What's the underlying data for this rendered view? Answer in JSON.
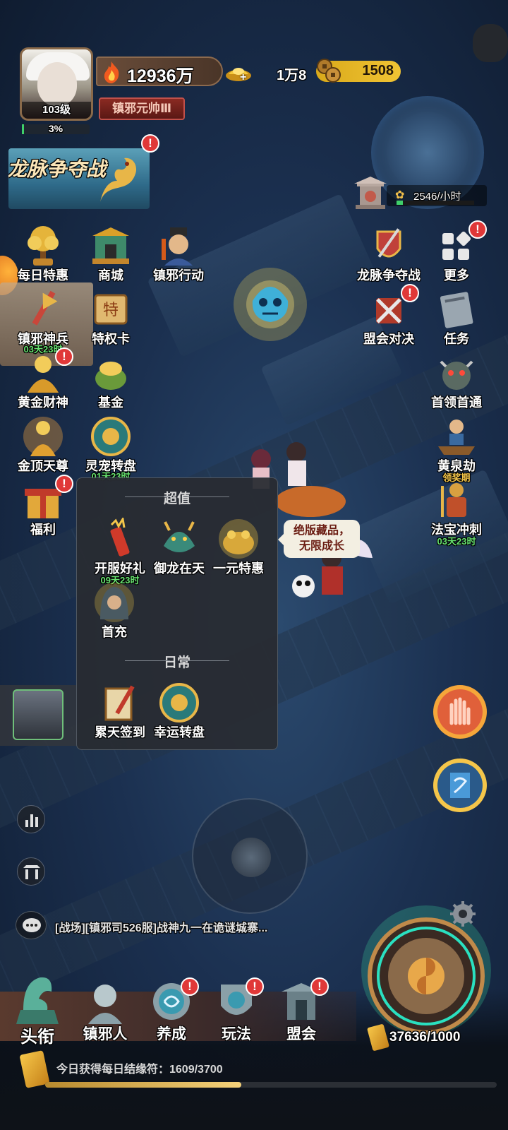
{
  "player": {
    "level": "103级",
    "exp_percent": "3%",
    "exp_fraction": 0.03,
    "combat_power": "12936万",
    "title": "镇邪元帅Ⅲ"
  },
  "currency": {
    "ingot_amount": "1万8",
    "coin_amount": "1508"
  },
  "minimap": {
    "production_rate": "2546/小时",
    "production_fraction": 0.08
  },
  "event_banner": {
    "title": "龙脉争夺战",
    "badge": "!"
  },
  "left_icons": [
    {
      "label": "每日特惠",
      "timer": "",
      "badge": ""
    },
    {
      "label": "商城",
      "timer": "",
      "badge": ""
    },
    {
      "label": "镇邪行动",
      "timer": "",
      "badge": ""
    },
    {
      "label": "镇邪神兵",
      "timer": "03天23时",
      "badge": ""
    },
    {
      "label": "特权卡",
      "timer": "",
      "badge": ""
    },
    {
      "label": "黄金财神",
      "timer": "",
      "badge": "!"
    },
    {
      "label": "基金",
      "timer": "",
      "badge": ""
    },
    {
      "label": "金顶天尊",
      "timer": "",
      "badge": ""
    },
    {
      "label": "灵宠转盘",
      "timer": "01天23时",
      "badge": ""
    },
    {
      "label": "福利",
      "timer": "",
      "badge": "!"
    }
  ],
  "right_icons": [
    {
      "label": "龙脉争夺战",
      "timer": "",
      "badge": ""
    },
    {
      "label": "更多",
      "timer": "",
      "badge": "!"
    },
    {
      "label": "盟会对决",
      "timer": "",
      "badge": "!"
    },
    {
      "label": "任务",
      "timer": "",
      "badge": ""
    },
    {
      "label": "首领首通",
      "timer": "",
      "badge": ""
    },
    {
      "label": "黄泉劫",
      "timer": "领奖期",
      "badge": ""
    },
    {
      "label": "法宝冲刺",
      "timer": "03天23时",
      "badge": ""
    }
  ],
  "popup": {
    "section_value": "超值",
    "section_daily": "日常",
    "value_items": [
      {
        "label": "开服好礼",
        "timer": "09天23时"
      },
      {
        "label": "御龙在天",
        "timer": ""
      },
      {
        "label": "一元特惠",
        "timer": ""
      },
      {
        "label": "首充",
        "timer": ""
      }
    ],
    "daily_items": [
      {
        "label": "累天签到",
        "timer": ""
      },
      {
        "label": "幸运转盘",
        "timer": ""
      }
    ]
  },
  "speech_bubble": {
    "line1": "绝版藏品，",
    "line2": "无限成长"
  },
  "chat": {
    "message": "[战场][镇邪司526服]战神九一在诡谜城寨..."
  },
  "bottom_nav": [
    {
      "label": "头衔",
      "badge": ""
    },
    {
      "label": "镇邪人",
      "badge": ""
    },
    {
      "label": "养成",
      "badge": "!"
    },
    {
      "label": "玩法",
      "badge": "!"
    },
    {
      "label": "盟会",
      "badge": "!"
    }
  ],
  "stamina": {
    "value": "37636/1000"
  },
  "daily_fate": {
    "text": "今日获得每日结缘符：1609/3700",
    "fraction": 0.435
  },
  "colors": {
    "timer_green": "#67e370",
    "badge_red": "#e03838",
    "coin_gold": "#f1c434"
  }
}
